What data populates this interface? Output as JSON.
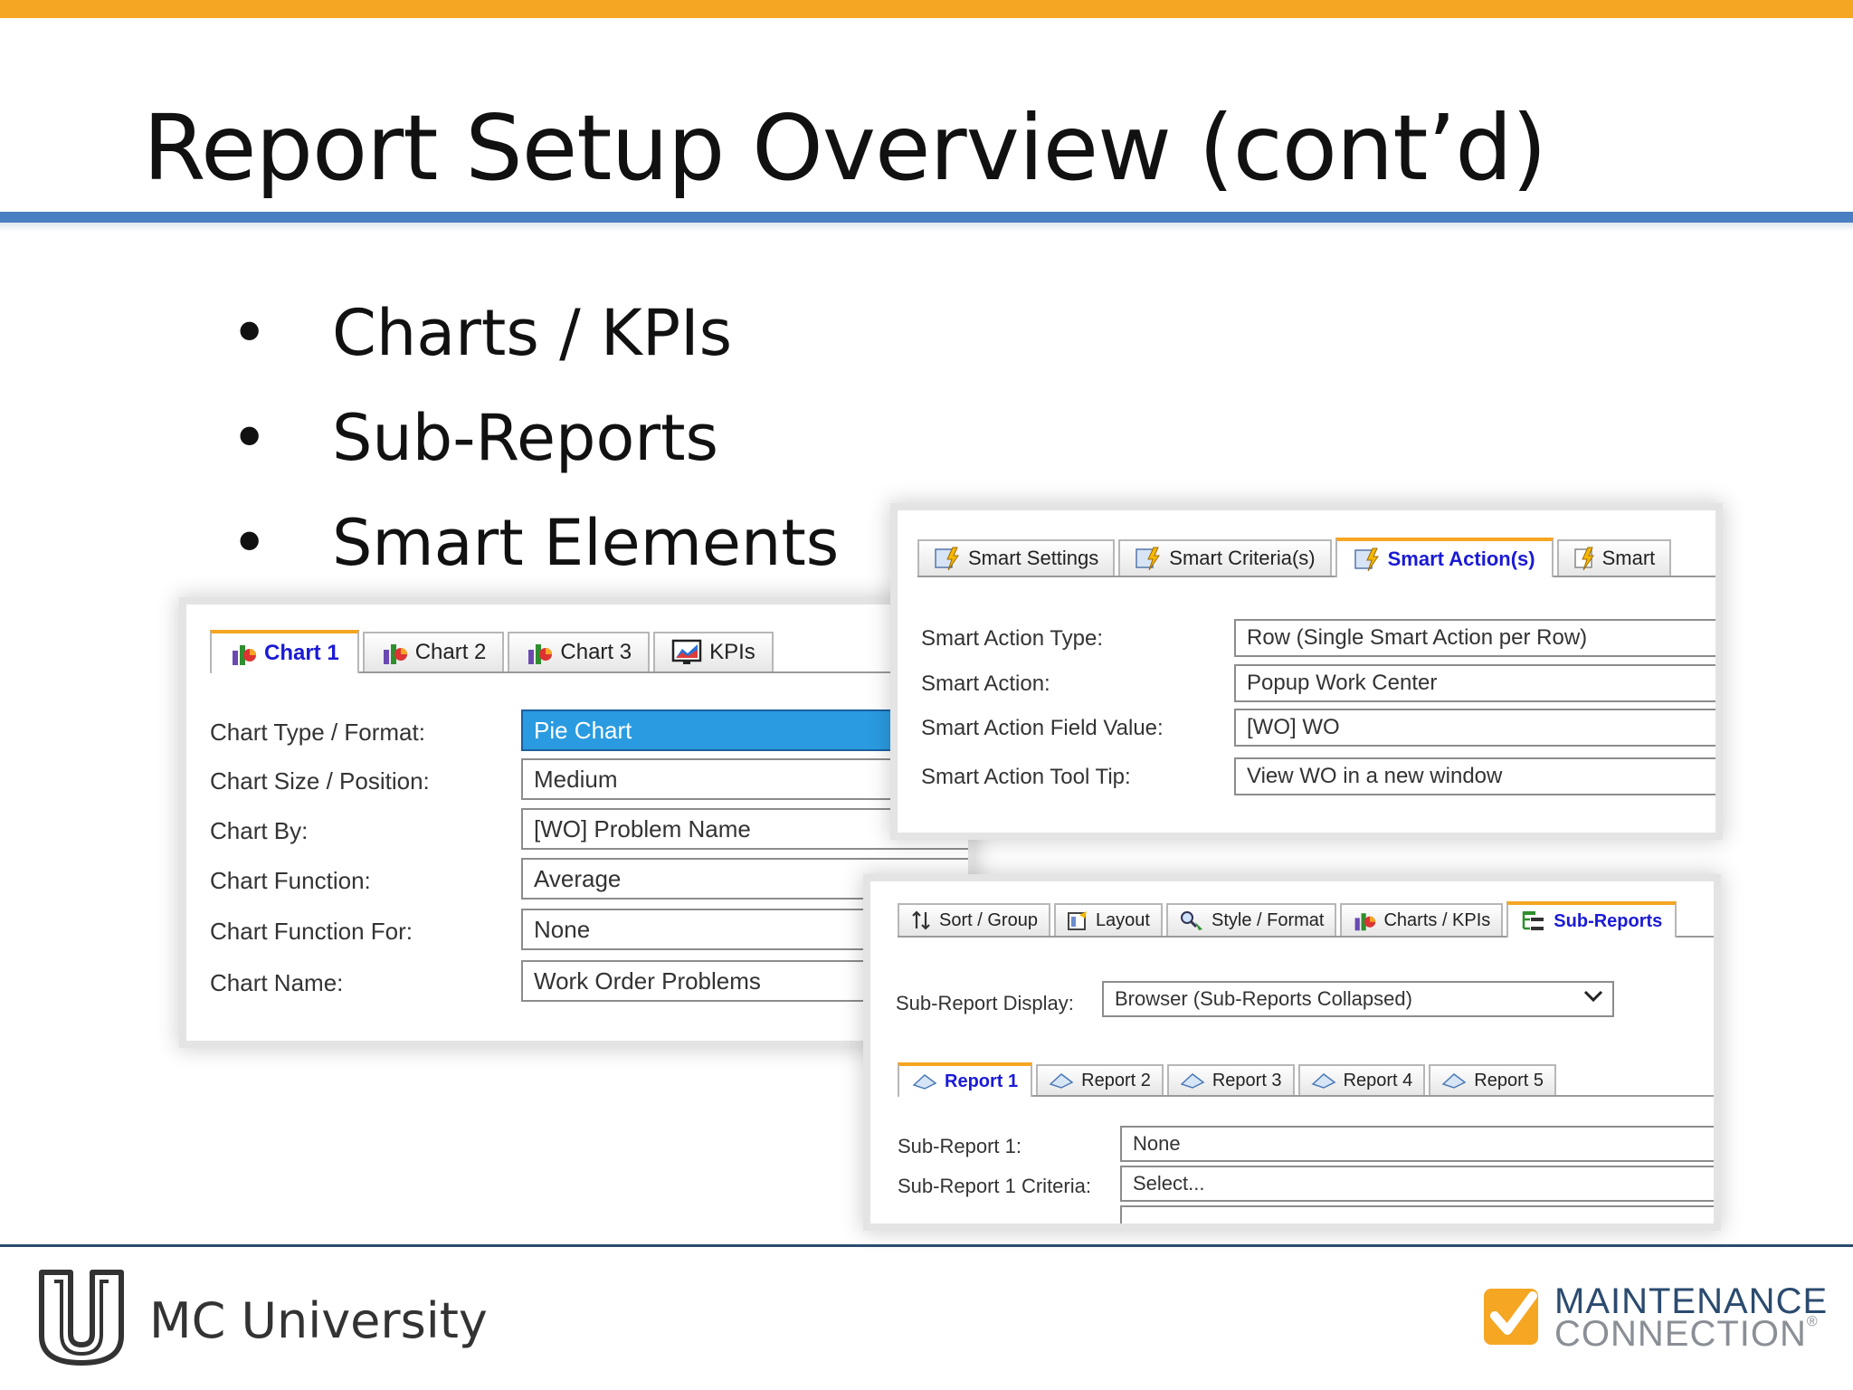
{
  "slide": {
    "title": "Report Setup Overview (cont’d)",
    "bullets": [
      "Charts / KPIs",
      "Sub-Reports",
      "Smart Elements"
    ]
  },
  "chart_panel": {
    "tabs": [
      "Chart 1",
      "Chart 2",
      "Chart 3",
      "KPIs"
    ],
    "active_tab": "Chart 1",
    "fields": [
      {
        "label": "Chart Type / Format:",
        "value": "Pie Chart"
      },
      {
        "label": "Chart Size / Position:",
        "value": "Medium"
      },
      {
        "label": "Chart By:",
        "value": "[WO] Problem Name"
      },
      {
        "label": "Chart Function:",
        "value": "Average"
      },
      {
        "label": "Chart Function For:",
        "value": "None"
      },
      {
        "label": "Chart Name:",
        "value": "Work Order Problems"
      }
    ]
  },
  "smart_panel": {
    "tabs": [
      "Smart Settings",
      "Smart Criteria(s)",
      "Smart Action(s)",
      "Smart"
    ],
    "active_tab": "Smart Action(s)",
    "fields": [
      {
        "label": "Smart Action Type:",
        "value": "Row (Single Smart Action per Row)"
      },
      {
        "label": "Smart Action:",
        "value": "Popup Work Center"
      },
      {
        "label": "Smart Action Field Value:",
        "value": "[WO] WO"
      },
      {
        "label": "Smart Action Tool Tip:",
        "value": "View WO in a new window"
      }
    ]
  },
  "subreport_panel": {
    "tabs": [
      "Sort / Group",
      "Layout",
      "Style / Format",
      "Charts / KPIs",
      "Sub-Reports"
    ],
    "active_tab": "Sub-Reports",
    "display_label": "Sub-Report Display:",
    "display_value": "Browser (Sub-Reports Collapsed)",
    "report_tabs": [
      "Report 1",
      "Report 2",
      "Report 3",
      "Report 4",
      "Report 5"
    ],
    "active_report_tab": "Report 1",
    "fields": [
      {
        "label": "Sub-Report 1:",
        "value": "None"
      },
      {
        "label": "Sub-Report 1 Criteria:",
        "value": "Select..."
      }
    ]
  },
  "footer": {
    "university": "MC University",
    "brand_line1": "MAINTENANCE",
    "brand_line2": "CONNECTION",
    "brand_mark": "®"
  },
  "colors": {
    "top_bar": "#f5a623",
    "title_rule": "#4a7ec2",
    "selected_field": "#2a9be0",
    "active_tab_text": "#1a1ad6",
    "brand_orange": "#f5a623",
    "brand_navy": "#2b4b6f"
  },
  "icons": {
    "chart_tab": "pie-chart-icon",
    "kpi_tab": "monitor-chart-icon",
    "smart_tab": "lightning-doc-icon",
    "sort_tab": "sort-arrows-icon",
    "layout_tab": "layout-icon",
    "style_tab": "magnifier-brush-icon",
    "subreports_tab": "tree-list-icon",
    "report_tab": "report-doc-icon",
    "dropdown": "chevron-down-icon"
  }
}
